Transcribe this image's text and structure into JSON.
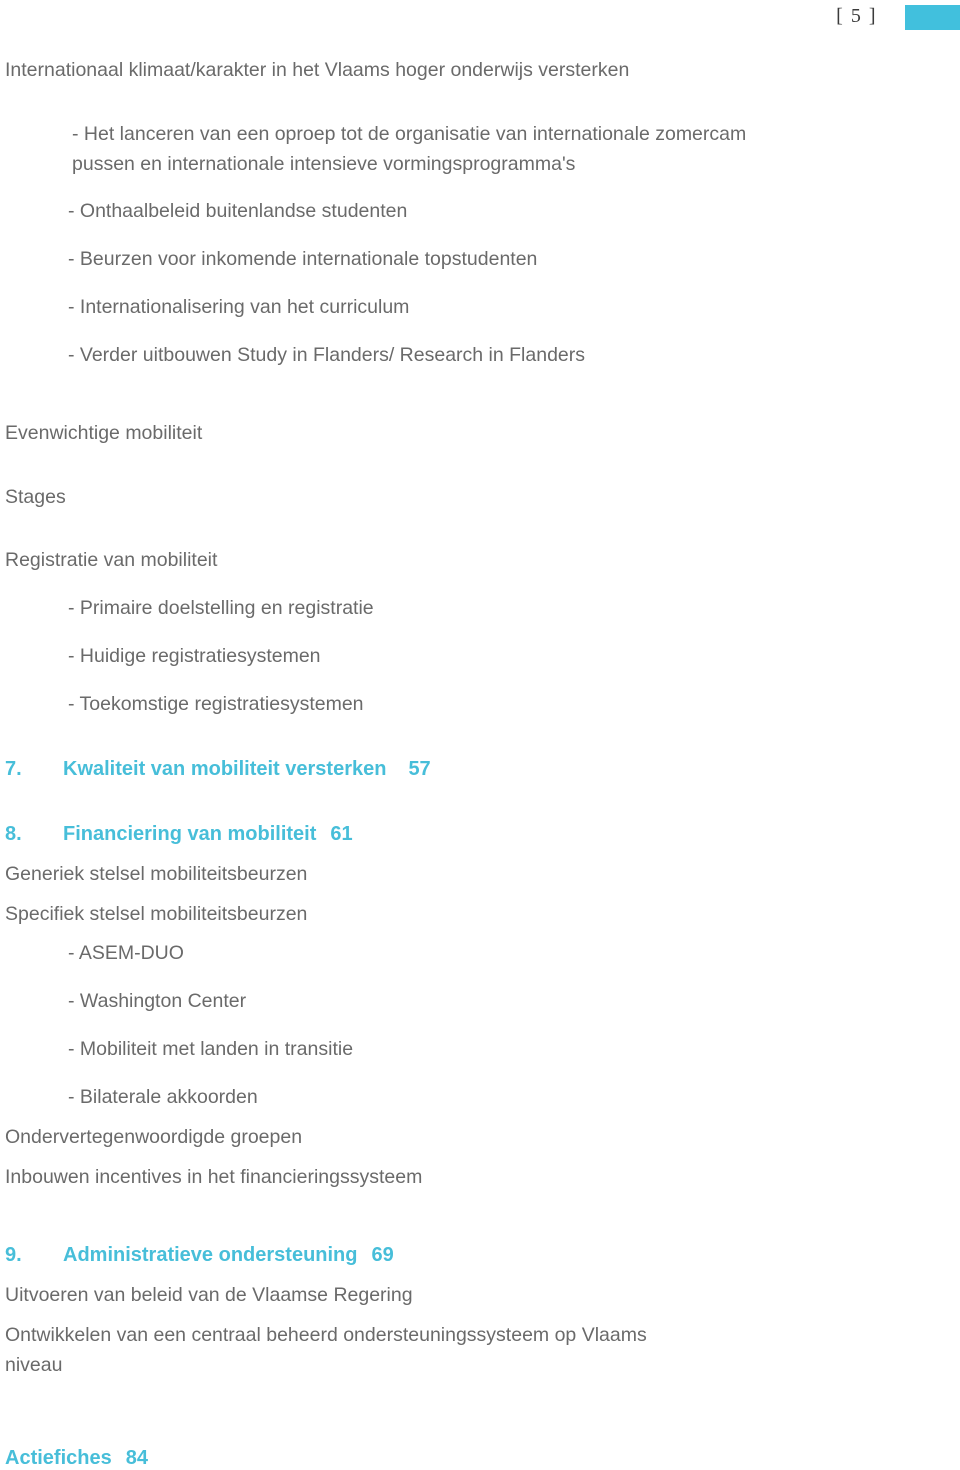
{
  "header": {
    "page_number": "[ 5 ]",
    "swatch_color": "#41c0dd"
  },
  "theme": {
    "accent": "#47bed9",
    "body_text": "#6a6a6a",
    "page_number_text": "#3b3b3b"
  },
  "toc": {
    "section_heading": "Internationaal klimaat/karakter in het Vlaams hoger onderwijs versterken",
    "items": [
      {
        "text": "- Het lanceren van een oproep tot de organisatie van internationale zomercam"
      },
      {
        "text": "pussen en internationale intensieve vormingsprogramma's"
      },
      {
        "text": "- Onthaalbeleid buitenlandse studenten"
      },
      {
        "text": "- Beurzen voor inkomende internationale topstudenten"
      },
      {
        "text": "- Internationalisering van het curriculum"
      },
      {
        "text": "- Verder uitbouwen Study in Flanders/ Research in Flanders"
      }
    ],
    "evenwichtige": "Evenwichtige mobiliteit",
    "stages": "Stages",
    "registratie": "Registratie van mobiliteit",
    "registratie_items": [
      {
        "text": "- Primaire doelstelling en registratie"
      },
      {
        "text": "- Huidige registratiesystemen"
      },
      {
        "text": "- Toekomstige registratiesystemen"
      }
    ],
    "chapter7": {
      "number": "7.",
      "title": "Kwaliteit van mobiliteit versterken",
      "page": "57"
    },
    "chapter8": {
      "number": "8.",
      "title": "Financiering van mobiliteit",
      "page": "61"
    },
    "generiek": "Generiek stelsel mobiliteitsbeurzen",
    "specifiek": "Specifiek stelsel mobiliteitsbeurzen",
    "specifiek_items": [
      {
        "text": "- ASEM-DUO"
      },
      {
        "text": "- Washington Center"
      },
      {
        "text": "- Mobiliteit met landen in transitie"
      },
      {
        "text": "- Bilaterale akkoorden"
      }
    ],
    "ondervertegenwoordigde": "Ondervertegenwoordigde groepen",
    "inbouwen": "Inbouwen incentives in het financieringssysteem",
    "chapter9": {
      "number": "9.",
      "title": "Administratieve ondersteuning",
      "page": "69"
    },
    "uitvoeren": "Uitvoeren van beleid van de Vlaamse Regering",
    "ontwikkelen_line1": "Ontwikkelen van een centraal beheerd ondersteuningssysteem op Vlaams",
    "ontwikkelen_line2": "niveau",
    "actiefiches": {
      "title": "Actiefiches",
      "page": "84"
    }
  }
}
